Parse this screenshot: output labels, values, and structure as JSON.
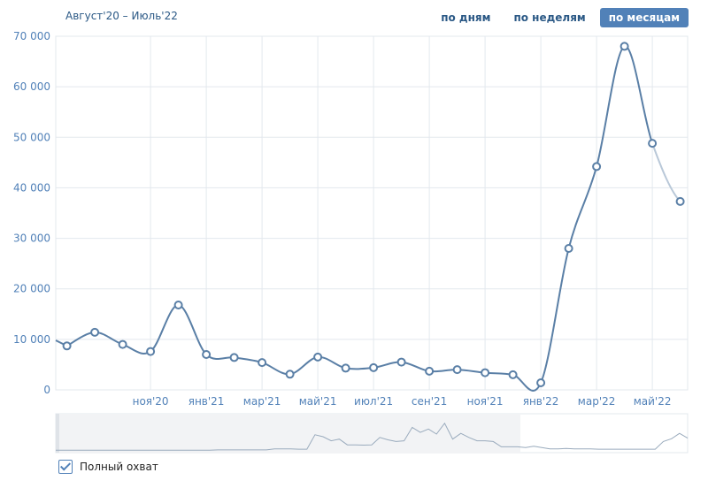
{
  "header": {
    "range_label": "Август'20 – Июль'22",
    "tabs": [
      {
        "label": "по дням",
        "active": false
      },
      {
        "label": "по неделям",
        "active": false
      },
      {
        "label": "по месяцам",
        "active": true
      }
    ]
  },
  "footer": {
    "checkbox_label": "Полный охват",
    "checked": true
  },
  "colors": {
    "line": "#5a7fa6",
    "grid": "#e3e8ee",
    "tick_text": "#5181b8",
    "navigator_fill": "#f2f3f5",
    "navigator_line": "#9aabbd"
  },
  "chart_data": {
    "type": "line",
    "title": "",
    "xlabel": "",
    "ylabel": "",
    "ylim": [
      0,
      70000
    ],
    "y_ticks": [
      0,
      10000,
      20000,
      30000,
      40000,
      50000,
      60000,
      70000
    ],
    "y_tick_labels": [
      "0",
      "10 000",
      "20 000",
      "30 000",
      "40 000",
      "50 000",
      "60 000",
      "70 000"
    ],
    "x_tick_labels": [
      "ноя'20",
      "янв'21",
      "мар'21",
      "май'21",
      "июл'21",
      "сен'21",
      "ноя'21",
      "янв'22",
      "мар'22",
      "май'22"
    ],
    "grid": true,
    "series": [
      {
        "x": [
          "2020-08",
          "2020-09",
          "2020-10",
          "2020-11",
          "2020-12",
          "2021-01",
          "2021-02",
          "2021-03",
          "2021-04",
          "2021-05",
          "2021-06",
          "2021-07",
          "2021-08",
          "2021-09",
          "2021-10",
          "2021-11",
          "2021-12",
          "2022-01",
          "2022-02",
          "2022-03",
          "2022-04",
          "2022-05",
          "2022-06",
          "2022-07"
        ],
        "values": [
          8700,
          11400,
          9000,
          7600,
          16800,
          7000,
          6400,
          5400,
          3100,
          6500,
          4300,
          4400,
          5500,
          3700,
          4000,
          3400,
          3000,
          1400,
          28000,
          44200,
          68000,
          48800,
          37300,
          37300
        ]
      }
    ]
  }
}
